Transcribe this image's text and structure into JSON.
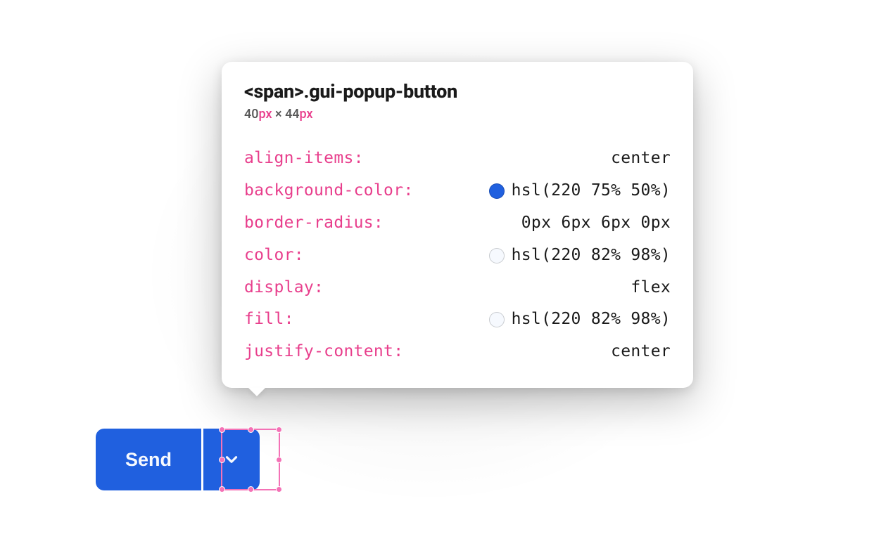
{
  "tooltip": {
    "selector_tag": "<span>",
    "selector_class": ".gui-popup-button",
    "dims_w": "40",
    "dims_h": "44",
    "px_unit": "px",
    "times": "×",
    "properties": [
      {
        "name": "align-items",
        "value": "center",
        "swatch": null
      },
      {
        "name": "background-color",
        "value": "hsl(220 75% 50%)",
        "swatch": "hsl(220,75%,50%)"
      },
      {
        "name": "border-radius",
        "value": "0px 6px 6px 0px",
        "swatch": null
      },
      {
        "name": "color",
        "value": "hsl(220 82% 98%)",
        "swatch": "hsl(220,82%,98%)"
      },
      {
        "name": "display",
        "value": "flex",
        "swatch": null
      },
      {
        "name": "fill",
        "value": "hsl(220 82% 98%)",
        "swatch": "hsl(220,82%,98%)"
      },
      {
        "name": "justify-content",
        "value": "center",
        "swatch": null
      }
    ]
  },
  "button": {
    "send_label": "Send"
  },
  "colors": {
    "accent_blue": "hsl(220,75%,50%)",
    "text_on_blue": "hsl(220,82%,98%)",
    "prop_pink": "#e83e8c",
    "selection_pink": "#f472b6"
  }
}
